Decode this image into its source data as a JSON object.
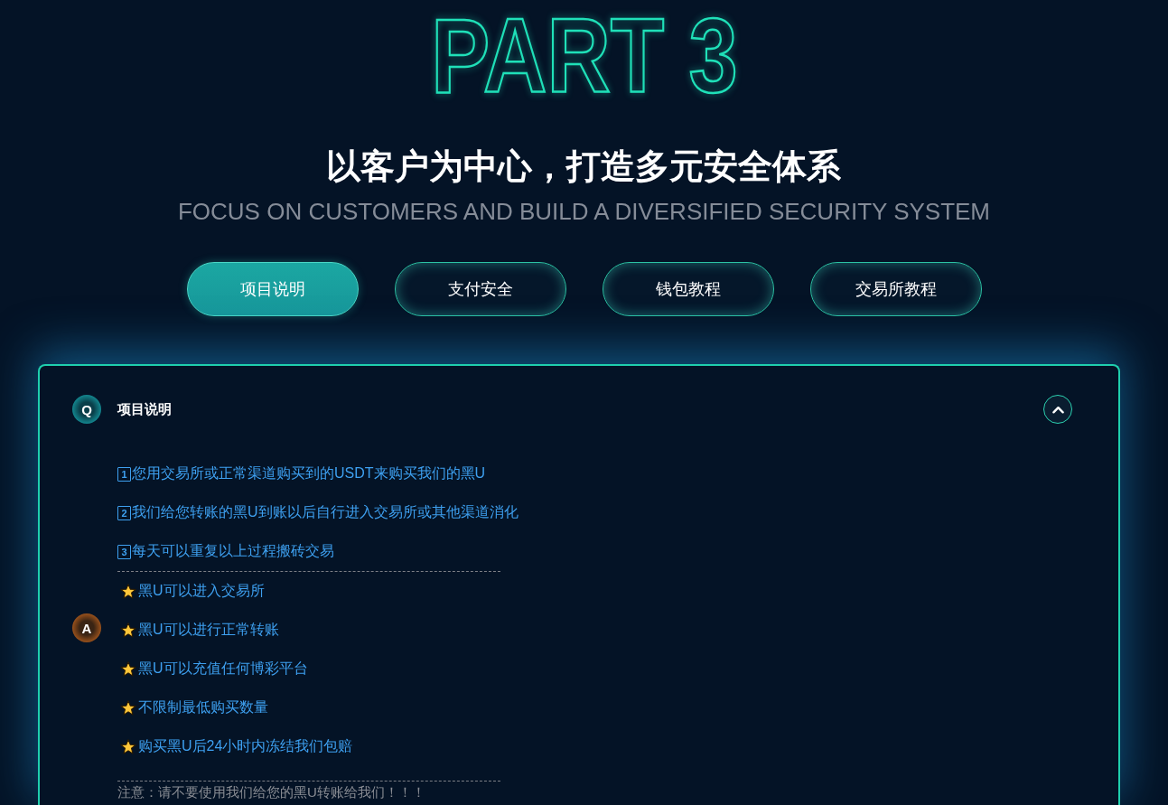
{
  "hero": {
    "title": "PART 3",
    "heading": "以客户为中心，打造多元安全体系",
    "subheading": "FOCUS ON CUSTOMERS AND BUILD A DIVERSIFIED SECURITY SYSTEM"
  },
  "tabs": [
    {
      "label": "项目说明",
      "selected": true
    },
    {
      "label": "支付安全",
      "selected": false
    },
    {
      "label": "钱包教程",
      "selected": false
    },
    {
      "label": "交易所教程",
      "selected": false
    }
  ],
  "faq": {
    "question_badge": "Q",
    "question": "项目说明",
    "expanded": true,
    "answer_badge": "A",
    "steps": [
      {
        "number": "1",
        "text": "您用交易所或正常渠道购买到的USDT来购买我们的黑U"
      },
      {
        "number": "2",
        "text": "我们给您转账的黑U到账以后自行进入交易所或其他渠道消化"
      },
      {
        "number": "3",
        "text": "每天可以重复以上过程搬砖交易"
      }
    ],
    "features": [
      {
        "text": "黑U可以进入交易所"
      },
      {
        "text": "黑U可以进行正常转账"
      },
      {
        "text": "黑U可以充值任何博彩平台"
      },
      {
        "text": "不限制最低购买数量"
      },
      {
        "text": "购买黑U后24小时内冻结我们包赔"
      }
    ],
    "note": "注意：请不要使用我们给您的黑U转账给我们！！！"
  }
}
